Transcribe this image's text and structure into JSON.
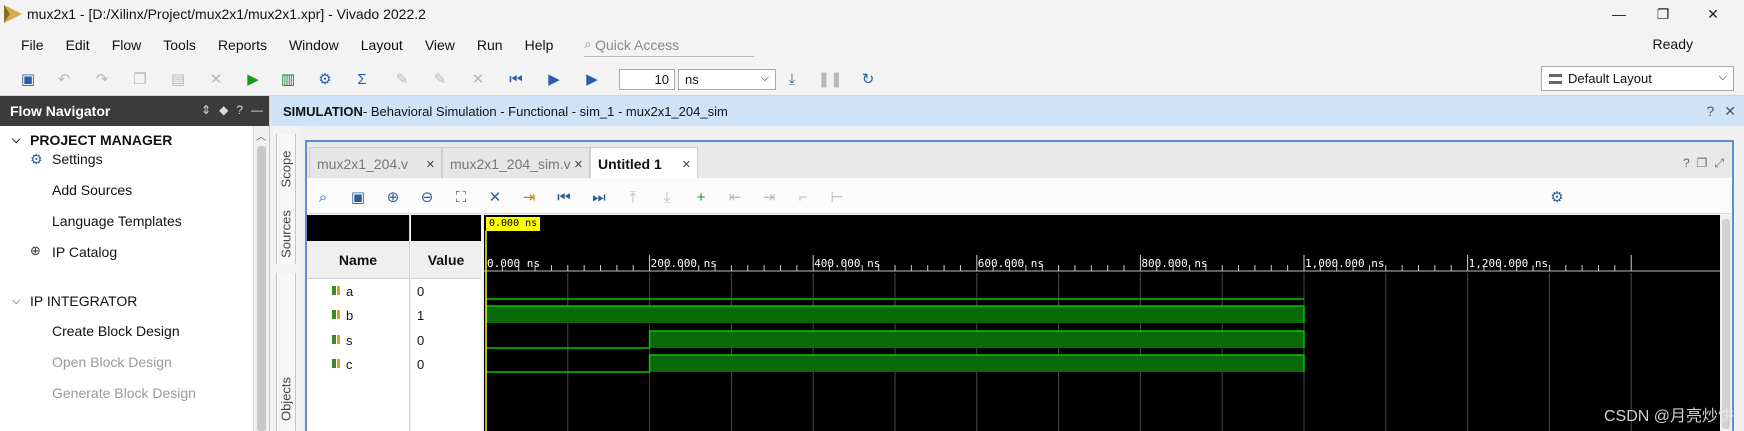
{
  "window": {
    "title": "mux2x1 - [D:/Xilinx/Project/mux2x1/mux2x1.xpr] - Vivado 2022.2",
    "controls": {
      "minimize": "—",
      "restore": "❐",
      "close": "✕"
    }
  },
  "menu": {
    "items": [
      "File",
      "Edit",
      "Flow",
      "Tools",
      "Reports",
      "Window",
      "Layout",
      "View",
      "Run",
      "Help"
    ],
    "quick_access_placeholder": "Quick Access",
    "status": "Ready"
  },
  "toolbar": {
    "run_time_value": "10",
    "time_unit": "ns",
    "layout": "Default Layout"
  },
  "flow_navigator": {
    "title": "Flow Navigator",
    "sections": [
      {
        "label": "PROJECT MANAGER",
        "children": [
          {
            "label": "Settings",
            "icon": "gear-icon"
          },
          {
            "label": "Add Sources"
          },
          {
            "label": "Language Templates"
          },
          {
            "label": "IP Catalog",
            "icon": "ip-catalog-icon"
          }
        ]
      },
      {
        "label": "IP INTEGRATOR",
        "children": [
          {
            "label": "Create Block Design"
          },
          {
            "label": "Open Block Design",
            "disabled": true
          },
          {
            "label": "Generate Block Design",
            "disabled": true
          }
        ]
      }
    ]
  },
  "simulation": {
    "header_bold": "SIMULATION",
    "header_rest": " - Behavioral Simulation - Functional - sim_1 - mux2x1_204_sim",
    "side_tabs": [
      "Scope",
      "Sources",
      "Objects"
    ],
    "tabs": [
      {
        "label": "mux2x1_204.v",
        "active": false
      },
      {
        "label": "mux2x1_204_sim.v",
        "active": false
      },
      {
        "label": "Untitled 1",
        "active": true
      }
    ],
    "name_header": "Name",
    "value_header": "Value",
    "cursor_label": "0.000 ns",
    "signals": [
      {
        "name": "a",
        "value": "0"
      },
      {
        "name": "b",
        "value": "1"
      },
      {
        "name": "s",
        "value": "0"
      },
      {
        "name": "c",
        "value": "0"
      }
    ],
    "tick_labels": [
      "0.000 ns",
      "200.000 ns",
      "400.000 ns",
      "600.000 ns",
      "800.000 ns",
      "1,000.000 ns",
      "1,200.000 ns"
    ],
    "time_range_ns": [
      0,
      1400
    ],
    "sim_end_ns": 1000,
    "waveforms": {
      "a": [
        [
          0,
          1000,
          0
        ]
      ],
      "b": [
        [
          0,
          1000,
          1
        ]
      ],
      "s": [
        [
          0,
          200,
          0
        ],
        [
          200,
          1000,
          1
        ]
      ],
      "c": [
        [
          0,
          200,
          0
        ],
        [
          200,
          1000,
          1
        ]
      ]
    },
    "colors": {
      "wave": "#00c800",
      "wave_fill": "#0a6a0a",
      "cursor": "#ffff00",
      "background": "#000000"
    }
  },
  "watermark": "CSDN @月亮炒饼"
}
